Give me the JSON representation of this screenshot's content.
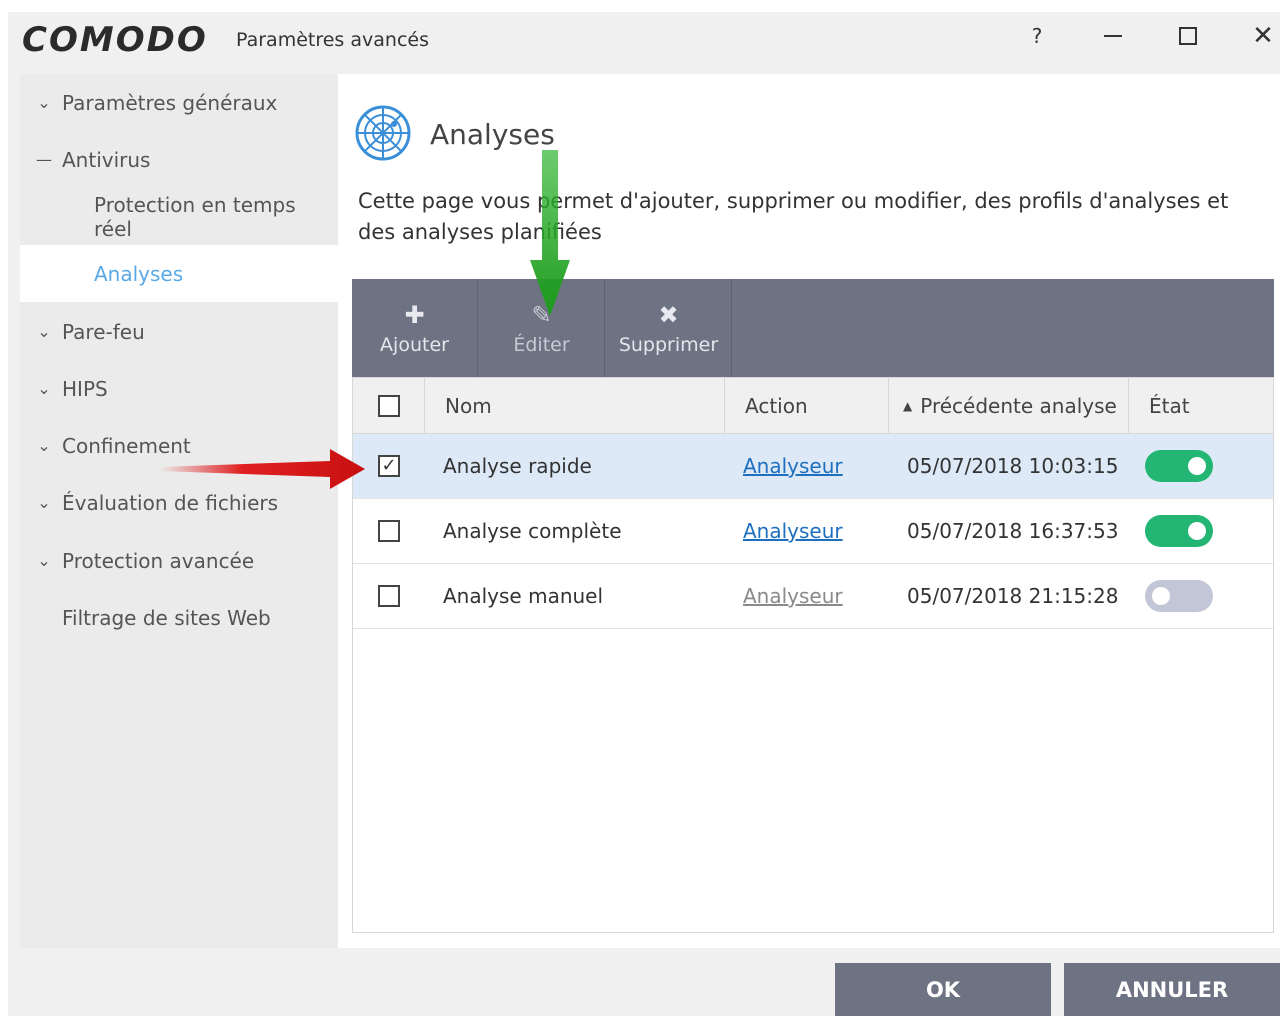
{
  "app": {
    "logo": "COMODO",
    "window_title": "Paramètres avancés",
    "controls": {
      "help": "?"
    }
  },
  "sidebar": {
    "items": [
      {
        "label": "Paramètres généraux",
        "expander": "chevron-down"
      },
      {
        "label": "Antivirus",
        "expander": "minus"
      },
      {
        "label": "Protection en temps réel",
        "level": 2
      },
      {
        "label": "Analyses",
        "level": 2,
        "active": true
      },
      {
        "label": "Pare-feu",
        "expander": "chevron-down"
      },
      {
        "label": "HIPS",
        "expander": "chevron-down"
      },
      {
        "label": "Confinement",
        "expander": "chevron-down"
      },
      {
        "label": "Évaluation de fichiers",
        "expander": "chevron-down"
      },
      {
        "label": "Protection avancée",
        "expander": "chevron-down"
      },
      {
        "label": "Filtrage de sites Web"
      }
    ]
  },
  "main": {
    "title": "Analyses",
    "icon": "globe-scan-icon",
    "description": "Cette page vous permet d'ajouter, supprimer ou modifier, des profils d'analyses et des analyses planifiées",
    "toolbar": {
      "add": {
        "label": "Ajouter",
        "icon": "plus-icon"
      },
      "edit": {
        "label": "Éditer",
        "icon": "pencil-icon"
      },
      "delete": {
        "label": "Supprimer",
        "icon": "cross-icon"
      }
    },
    "table": {
      "columns": {
        "name": "Nom",
        "action": "Action",
        "previous": "Précédente analyse",
        "state": "État"
      },
      "sorted_column": "previous",
      "rows": [
        {
          "name": "Analyse rapide",
          "action": "Analyseur",
          "previous": "05/07/2018 10:03:15",
          "enabled": true,
          "checked": true,
          "selected": true
        },
        {
          "name": "Analyse complète",
          "action": "Analyseur",
          "previous": "05/07/2018 16:37:53",
          "enabled": true,
          "checked": false
        },
        {
          "name": "Analyse manuel",
          "action": "Analyseur",
          "previous": "05/07/2018 21:15:28",
          "enabled": false,
          "checked": false
        }
      ]
    }
  },
  "footer": {
    "ok": "OK",
    "cancel": "ANNULER"
  },
  "colors": {
    "accent": "#5aa9e6",
    "toolbar": "#6e7383",
    "toggle_on": "#22b573",
    "toggle_off": "#c3c6d6",
    "link": "#1f6fbf",
    "annotation_red": "#e02020",
    "annotation_green": "#2fb52f"
  }
}
